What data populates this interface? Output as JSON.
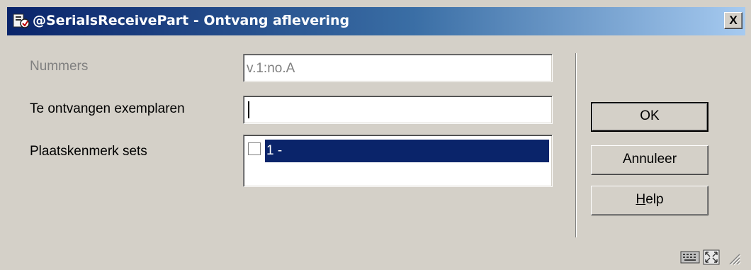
{
  "window": {
    "title": "@SerialsReceivePart - Ontvang aflevering",
    "close_label": "X"
  },
  "form": {
    "nummers_label": "Nummers",
    "nummers_value": "v.1:no.A",
    "exemplaren_label": "Te ontvangen exemplaren",
    "exemplaren_value": "",
    "sets_label": "Plaatskenmerk sets",
    "sets_items": [
      {
        "label": "1 -",
        "checked": false,
        "selected": true
      }
    ]
  },
  "buttons": {
    "ok": "OK",
    "cancel": "Annuleer",
    "help_first": "H",
    "help_rest": "elp"
  },
  "status_icons": [
    "keyboard-icon",
    "resize-window-icon",
    "size-grip-icon"
  ],
  "colors": {
    "titlebar_start": "#0a246a",
    "titlebar_end": "#a6caf0",
    "face": "#d4d0c8",
    "selection": "#0a246a"
  }
}
